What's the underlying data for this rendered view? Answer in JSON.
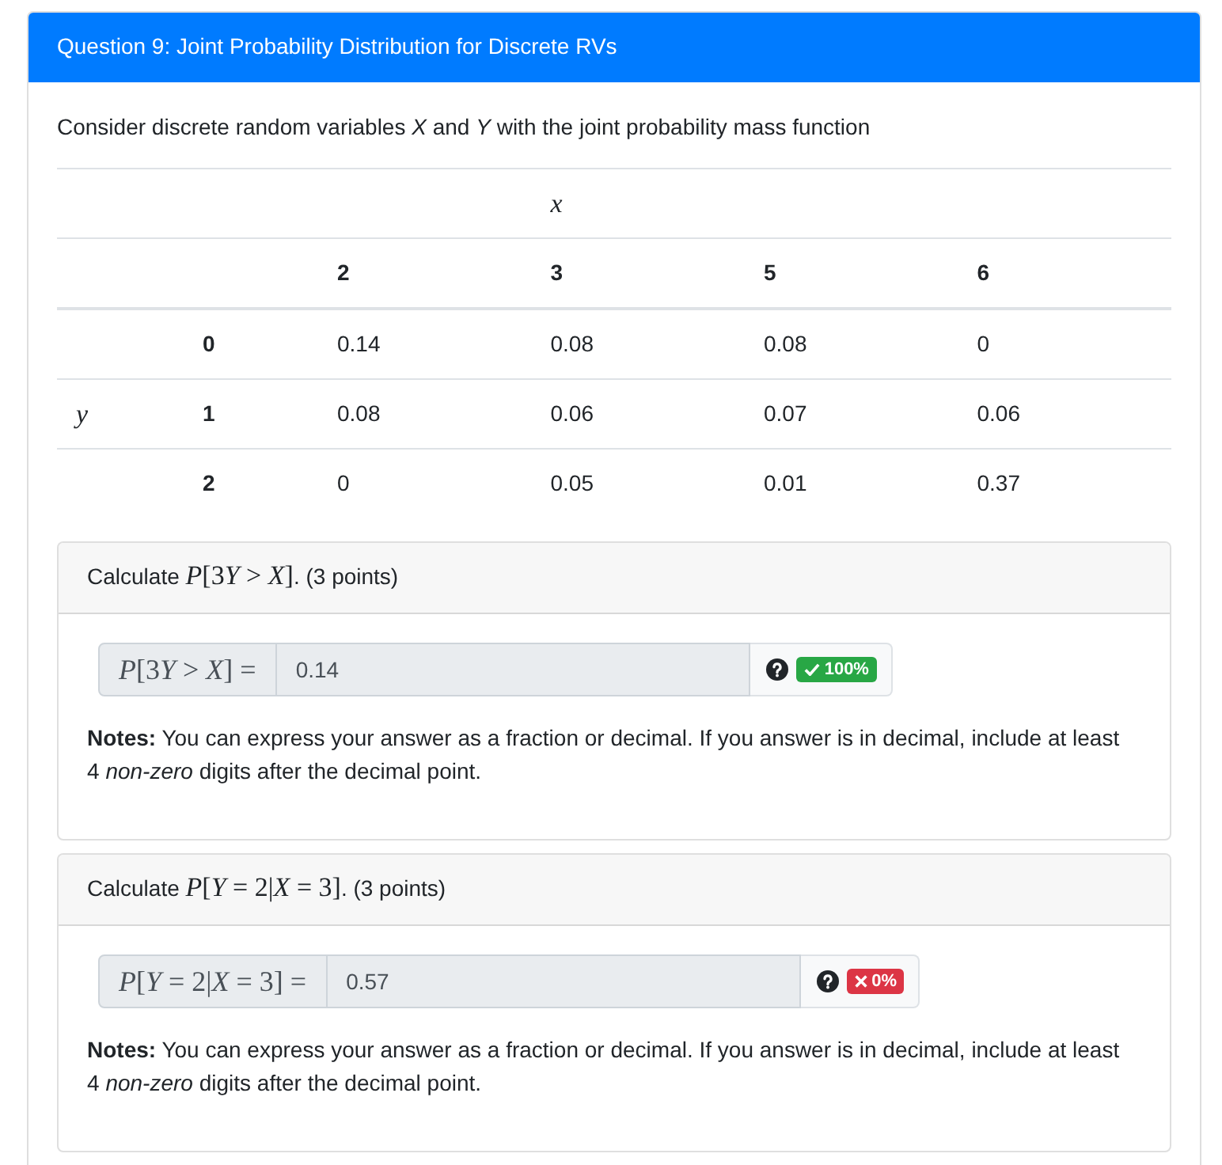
{
  "question": {
    "title": "Question 9: Joint Probability Distribution for Discrete RVs",
    "intro": "Consider discrete random variables *X* and *Y* with the joint probability mass function",
    "table": {
      "column_variable": "x",
      "row_variable": "y",
      "columns": [
        "2",
        "3",
        "5",
        "6"
      ],
      "rows": [
        {
          "label": "0",
          "values": [
            "0.14",
            "0.08",
            "0.08",
            "0"
          ]
        },
        {
          "label": "1",
          "values": [
            "0.08",
            "0.06",
            "0.07",
            "0.06"
          ]
        },
        {
          "label": "2",
          "values": [
            "0",
            "0.05",
            "0.01",
            "0.37"
          ]
        }
      ]
    },
    "parts": [
      {
        "prompt": "Calculate",
        "math": "P[3Y > X]",
        "suffix": ". (3 points)",
        "answer_label": "P[3Y > X] =",
        "answer": "0.14",
        "result": {
          "correct": true,
          "score": "100%"
        },
        "notes": "**Notes:** You can express your answer as a fraction or decimal. If you answer is in decimal, include at least 4 *non-zero* digits after the decimal point."
      },
      {
        "prompt": "Calculate",
        "math": "P[Y = 2|X = 3]",
        "suffix": ". (3 points)",
        "answer_label": "P[Y = 2|X = 3] =",
        "answer": "0.57",
        "result": {
          "correct": false,
          "score": "0%"
        },
        "notes": "**Notes:** You can express your answer as a fraction or decimal. If you answer is in decimal, include at least 4 *non-zero* digits after the decimal point."
      }
    ]
  }
}
